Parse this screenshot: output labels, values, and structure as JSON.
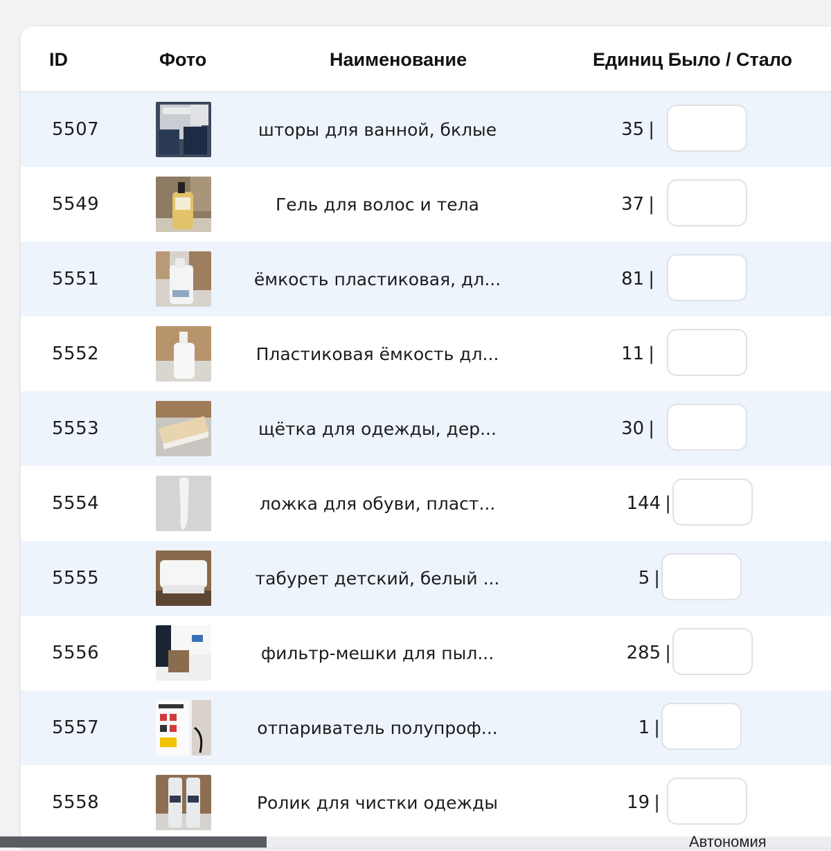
{
  "table": {
    "headers": {
      "id": "ID",
      "photo": "Фото",
      "name": "Наименование",
      "units": "Единиц Было / Стало"
    },
    "rows": [
      {
        "id": "5507",
        "name": "шторы для ванной, бклые",
        "qty": "35",
        "photo": "shower-curtain-package-photo"
      },
      {
        "id": "5549",
        "name": "Гель для волос и тела",
        "qty": "37",
        "photo": "gel-bottle-photo"
      },
      {
        "id": "5551",
        "name": "ёмкость пластиковая, дл...",
        "qty": "81",
        "photo": "plastic-bottle-photo"
      },
      {
        "id": "5552",
        "name": "Пластиковая ёмкость дл...",
        "qty": "11",
        "photo": "plastic-container-photo"
      },
      {
        "id": "5553",
        "name": "щётка для одежды, дер...",
        "qty": "30",
        "photo": "clothes-brush-photo"
      },
      {
        "id": "5554",
        "name": "ложка для обуви, пласт...",
        "qty": "144",
        "photo": "shoe-horn-photo"
      },
      {
        "id": "5555",
        "name": "табурет детский, белый ...",
        "qty": "5",
        "photo": "kids-stool-photo"
      },
      {
        "id": "5556",
        "name": "фильтр-мешки для пыл...",
        "qty": "285",
        "photo": "filter-bags-photo"
      },
      {
        "id": "5557",
        "name": "отпариватель полупроф...",
        "qty": "1",
        "photo": "steamer-box-photo"
      },
      {
        "id": "5558",
        "name": "Ролик для чистки одежды",
        "qty": "19",
        "photo": "lint-roller-photo"
      }
    ],
    "separator": "|"
  },
  "taskbar": {
    "label": "Автономия"
  },
  "colors": {
    "row_stripe": "#eef4fc",
    "header_border": "#dcdde2",
    "input_border": "#dfe1e6"
  }
}
